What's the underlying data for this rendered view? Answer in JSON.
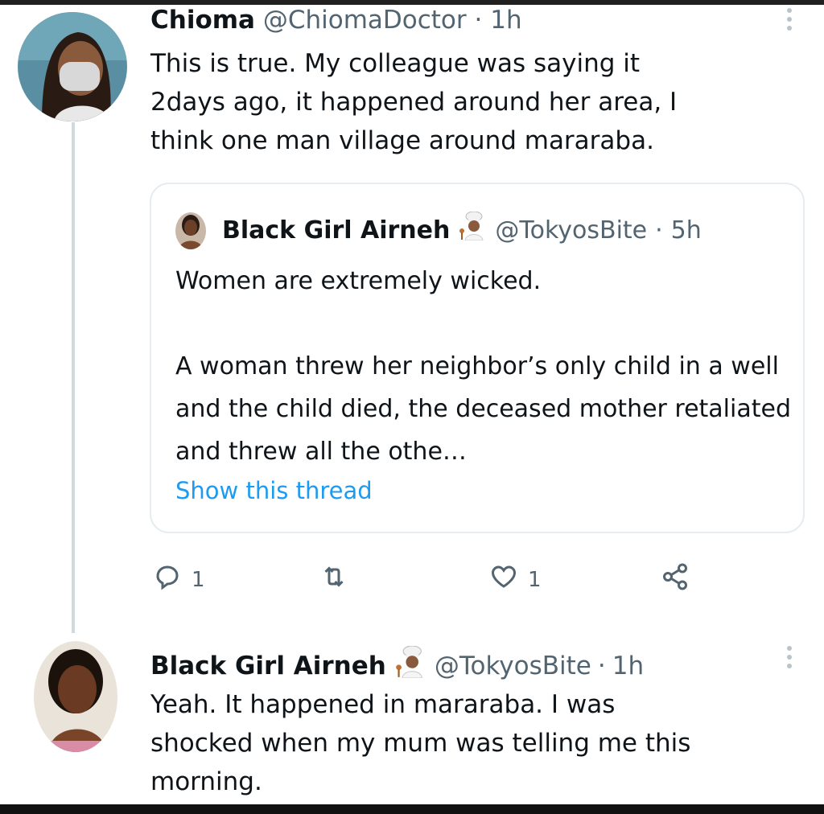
{
  "reply": {
    "name": "Chioma",
    "handle": "@ChiomaDoctor",
    "time": "1h",
    "text": "This is true. My colleague was saying it\n2days ago, it happened around her area, I\nthink one man village around mararaba."
  },
  "quoted": {
    "name": "Black Girl Airneh",
    "handle": "@TokyosBite",
    "time": "5h",
    "paragraph1": "Women are extremely wicked.",
    "paragraph2": "A woman threw her neighbor’s only child in a well and the child died, the deceased mother retaliated and threw all the othe…",
    "show_thread": "Show this thread"
  },
  "actions": {
    "reply_count": "1",
    "like_count": "1"
  },
  "second": {
    "name": "Black Girl Airneh",
    "handle": "@TokyosBite",
    "time": "1h",
    "text": "Yeah. It happened in mararaba. I was\nshocked when my mum was telling me this\nmorning."
  },
  "separator": "·",
  "colors": {
    "text": "#0f1419",
    "secondary": "#536471",
    "link": "#1d9bf0",
    "border": "#e6ecf0"
  },
  "icons": [
    "reply-icon",
    "retweet-icon",
    "like-icon",
    "share-icon",
    "more-icon",
    "chef-emoji"
  ]
}
